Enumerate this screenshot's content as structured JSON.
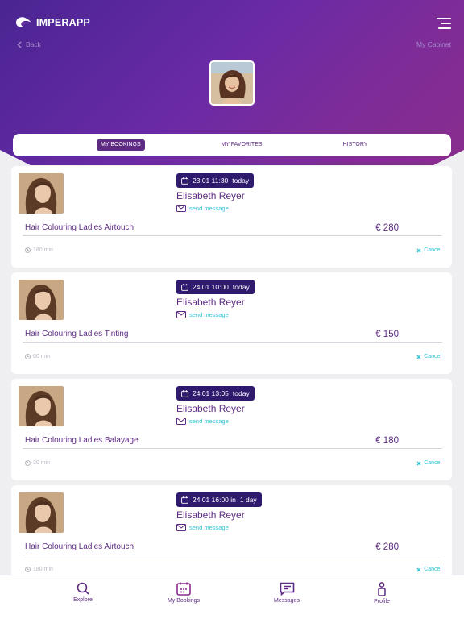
{
  "header": {
    "brand": "IMPERAPP",
    "back_label": "Back",
    "cabinet_label": "My Cabinet"
  },
  "tabs": [
    {
      "label": "MY BOOKINGS",
      "active": true
    },
    {
      "label": "MY FAVORITES",
      "active": false
    },
    {
      "label": "HISTORY",
      "active": false
    }
  ],
  "bookings": [
    {
      "date": "23.01 11:30",
      "when": "today",
      "stylist": "Elisabeth Reyer",
      "message_label": "send message",
      "service": "Hair Colouring Ladies Airtouch",
      "price": "€ 280",
      "duration": "180 min",
      "cancel_label": "Cancel"
    },
    {
      "date": "24.01 10:00",
      "when": "today",
      "stylist": "Elisabeth Reyer",
      "message_label": "send message",
      "service": "Hair Colouring Ladies Tinting",
      "price": "€ 150",
      "duration": "60 min",
      "cancel_label": "Cancel"
    },
    {
      "date": "24.01 13:05",
      "when": "today",
      "stylist": "Elisabeth Reyer",
      "message_label": "send message",
      "service": "Hair Colouring Ladies Balayage",
      "price": "€ 180",
      "duration": "30 min",
      "cancel_label": "Cancel"
    },
    {
      "date": "24.01 16:00 in",
      "when": "1 day",
      "stylist": "Elisabeth Reyer",
      "message_label": "send message",
      "service": "Hair Colouring Ladies Airtouch",
      "price": "€ 280",
      "duration": "180 min",
      "cancel_label": "Cancel"
    }
  ],
  "nav": [
    {
      "label": "Explore",
      "icon": "search-icon"
    },
    {
      "label": "My Bookings",
      "icon": "calendar-icon"
    },
    {
      "label": "Messages",
      "icon": "message-icon"
    },
    {
      "label": "Profile",
      "icon": "person-icon"
    }
  ],
  "colors": {
    "primary": "#5d2b82",
    "accent": "#2ec4d6",
    "badge": "#2f1a6e",
    "hero_start": "#4a2592",
    "hero_end": "#8a2d8e"
  }
}
